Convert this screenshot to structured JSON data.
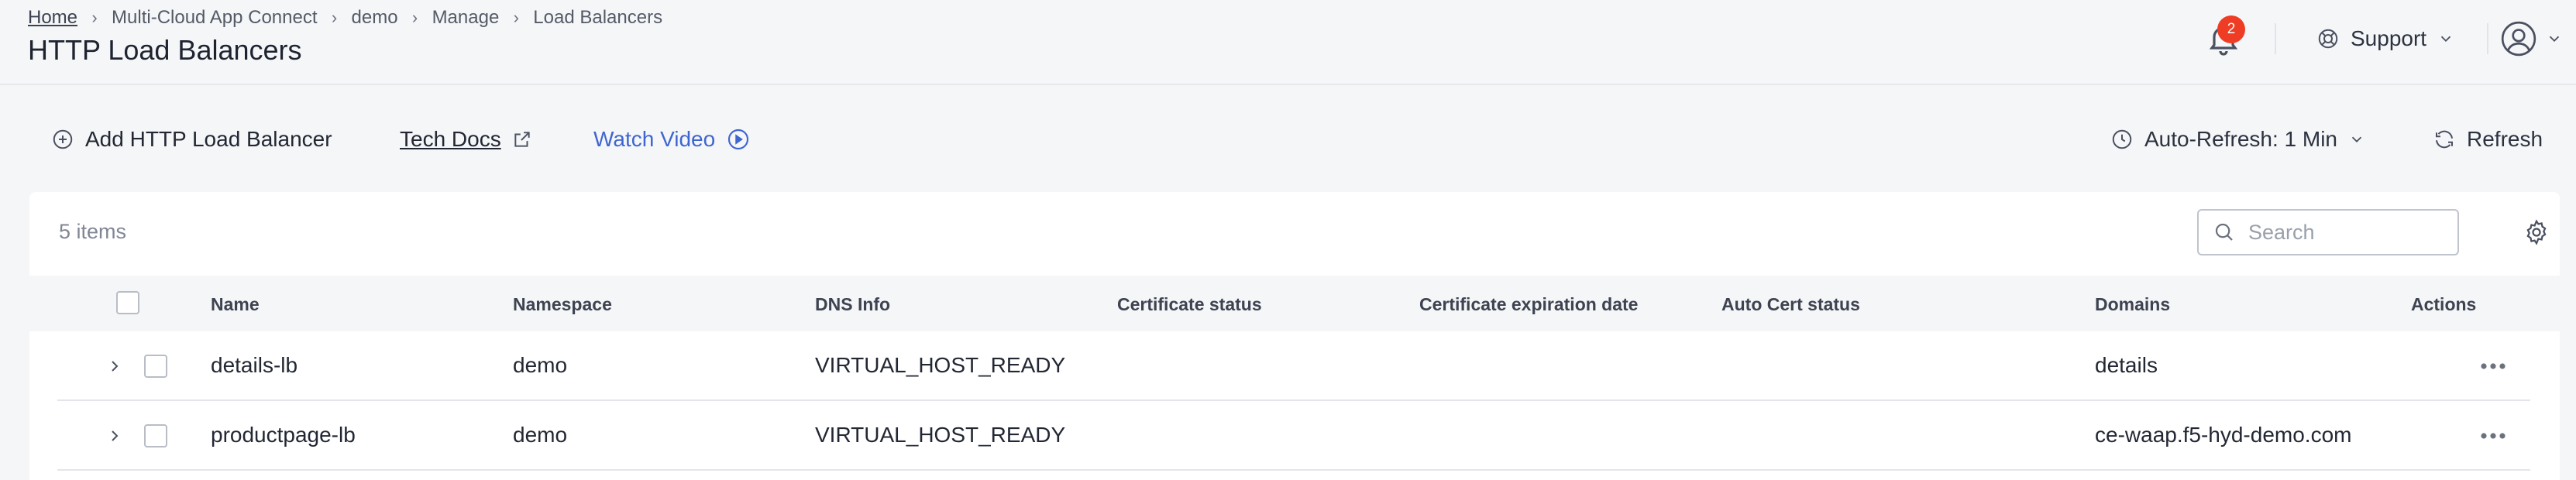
{
  "breadcrumb": {
    "items": [
      "Home",
      "Multi-Cloud App Connect",
      "demo",
      "Manage",
      "Load Balancers"
    ],
    "separator": ">"
  },
  "page": {
    "title": "HTTP Load Balancers"
  },
  "header": {
    "notifications_count": "2",
    "support_label": "Support",
    "icons": [
      "bell-icon",
      "lifebuoy-icon",
      "chevron-down-icon",
      "user-avatar-icon"
    ]
  },
  "toolbar": {
    "add_label": "Add HTTP Load Balancer",
    "docs_label": "Tech Docs",
    "video_label": "Watch Video",
    "auto_refresh_label": "Auto-Refresh: 1 Min",
    "refresh_label": "Refresh"
  },
  "table": {
    "items_count": "5 items",
    "search_placeholder": "Search",
    "columns": [
      "Name",
      "Namespace",
      "DNS Info",
      "Certificate status",
      "Certificate expiration date",
      "Auto Cert status",
      "Domains",
      "Actions"
    ],
    "rows": [
      {
        "name": "details-lb",
        "namespace": "demo",
        "dns_info": "VIRTUAL_HOST_READY",
        "cert_status": "",
        "cert_expiration": "",
        "auto_cert_status": "",
        "domains": "details"
      },
      {
        "name": "productpage-lb",
        "namespace": "demo",
        "dns_info": "VIRTUAL_HOST_READY",
        "cert_status": "",
        "cert_expiration": "",
        "auto_cert_status": "",
        "domains": "ce-waap.f5-hyd-demo.com"
      }
    ]
  },
  "colors": {
    "accent_link": "#3f66d0",
    "badge": "#ee3d24",
    "background": "#f5f6f8",
    "card": "#ffffff"
  }
}
